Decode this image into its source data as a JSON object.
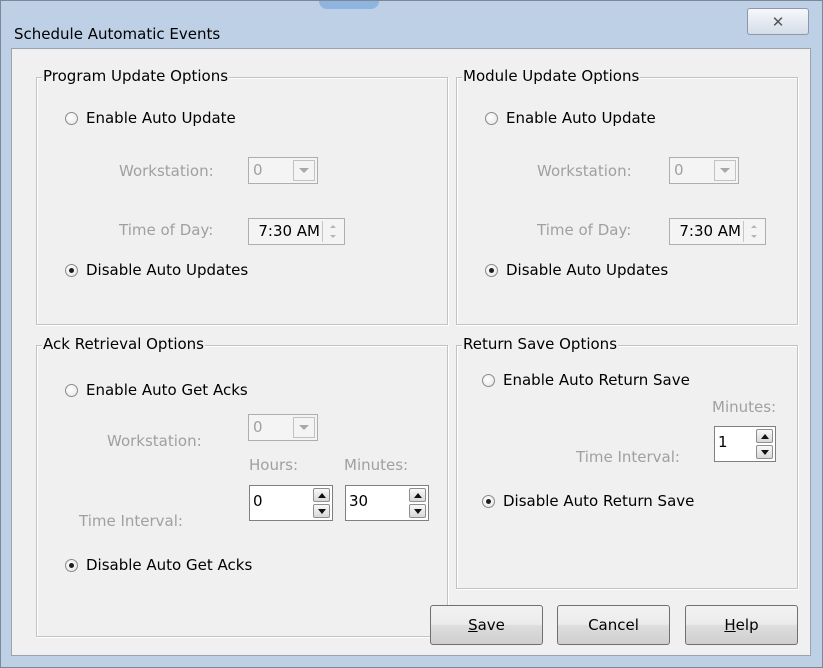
{
  "window": {
    "title": "Schedule Automatic Events",
    "close_glyph": "✕"
  },
  "program_update": {
    "title": "Program Update Options",
    "enable_label": "Enable Auto Update",
    "workstation_label": "Workstation:",
    "workstation_value": "0",
    "time_label": "Time of Day:",
    "time_value": "7:30 AM",
    "disable_label": "Disable Auto Updates",
    "selected": "disable"
  },
  "module_update": {
    "title": "Module Update Options",
    "enable_label": "Enable Auto Update",
    "workstation_label": "Workstation:",
    "workstation_value": "0",
    "time_label": "Time of Day:",
    "time_value": "7:30 AM",
    "disable_label": "Disable Auto Updates",
    "selected": "disable"
  },
  "ack_retrieval": {
    "title": "Ack Retrieval Options",
    "enable_label": "Enable Auto Get Acks",
    "workstation_label": "Workstation:",
    "workstation_value": "0",
    "hours_label": "Hours:",
    "minutes_label": "Minutes:",
    "interval_label": "Time Interval:",
    "hours_value": "0",
    "minutes_value": "30",
    "disable_label": "Disable Auto Get Acks",
    "selected": "disable"
  },
  "return_save": {
    "title": "Return Save Options",
    "enable_label": "Enable Auto Return Save",
    "minutes_label": "Minutes:",
    "interval_label": "Time Interval:",
    "minutes_value": "1",
    "disable_label": "Disable Auto Return Save",
    "selected": "disable"
  },
  "buttons": {
    "save_mnemonic": "S",
    "save_rest": "ave",
    "cancel": "Cancel",
    "help_mnemonic": "H",
    "help_rest": "elp"
  }
}
